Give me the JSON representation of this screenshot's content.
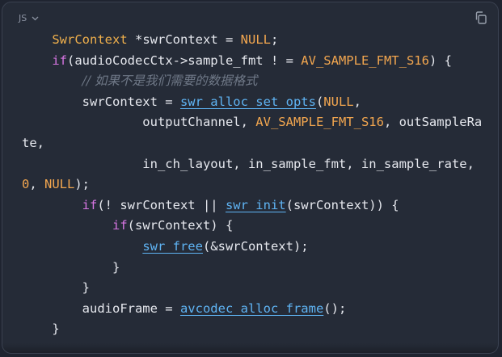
{
  "header": {
    "language_label": "JS",
    "copy_icon": "copy-icon",
    "chevron_icon": "chevron-down-icon"
  },
  "code": {
    "lines": [
      [
        {
          "t": "    "
        },
        {
          "t": "SwrContext",
          "c": "type"
        },
        {
          "t": " "
        },
        {
          "t": "*",
          "c": "ptr"
        },
        {
          "t": "swrContext = "
        },
        {
          "t": "NULL",
          "c": "cst"
        },
        {
          "t": ";"
        }
      ],
      [
        {
          "t": "    "
        },
        {
          "t": "if",
          "c": "kw"
        },
        {
          "t": "(audioCodecCtx->sample_fmt ! = "
        },
        {
          "t": "AV_SAMPLE_FMT_S16",
          "c": "cst"
        },
        {
          "t": ") {"
        }
      ],
      [
        {
          "t": "        "
        },
        {
          "t": "// 如果不是我们需要的数据格式",
          "c": "cmt"
        }
      ],
      [
        {
          "t": "        swrContext = "
        },
        {
          "t": "swr_alloc_set_opts",
          "c": "fn"
        },
        {
          "t": "("
        },
        {
          "t": "NULL",
          "c": "cst"
        },
        {
          "t": ","
        }
      ],
      [
        {
          "t": "                outputChannel, "
        },
        {
          "t": "AV_SAMPLE_FMT_S16",
          "c": "cst"
        },
        {
          "t": ", outSampleRa"
        }
      ],
      [
        {
          "t": "te,"
        }
      ],
      [
        {
          "t": "                in_ch_layout, in_sample_fmt, in_sample_rate,"
        }
      ],
      [
        {
          "t": "0",
          "c": "cst"
        },
        {
          "t": ", "
        },
        {
          "t": "NULL",
          "c": "cst"
        },
        {
          "t": ");"
        }
      ],
      [
        {
          "t": "        "
        },
        {
          "t": "if",
          "c": "kw"
        },
        {
          "t": "(! swrContext || "
        },
        {
          "t": "swr_init",
          "c": "fn"
        },
        {
          "t": "(swrContext)) {"
        }
      ],
      [
        {
          "t": "            "
        },
        {
          "t": "if",
          "c": "kw"
        },
        {
          "t": "(swrContext) {"
        }
      ],
      [
        {
          "t": "                "
        },
        {
          "t": "swr_free",
          "c": "fn"
        },
        {
          "t": "(&swrContext);"
        }
      ],
      [
        {
          "t": "            }"
        }
      ],
      [
        {
          "t": "        }"
        }
      ],
      [
        {
          "t": "        audioFrame = "
        },
        {
          "t": "avcodec_alloc_frame",
          "c": "fn"
        },
        {
          "t": "();"
        }
      ],
      [
        {
          "t": "    }"
        }
      ]
    ]
  }
}
